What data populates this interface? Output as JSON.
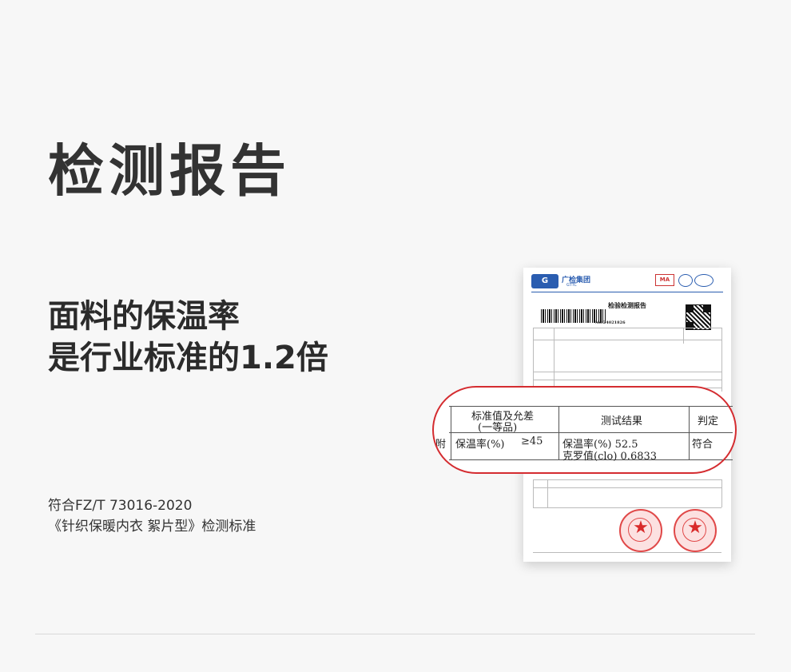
{
  "title": "检测报告",
  "headline": {
    "line1": "面料的保温率",
    "line2": "是行业标准的1.2倍"
  },
  "standard": {
    "line1": "符合FZ/T 73016-2020",
    "line2": "《针织保暖内衣 絮片型》检测标准"
  },
  "report": {
    "logo_label": "广检集团",
    "logo_sub": "GTTC",
    "ma_label": "MA",
    "doc_title": "检验检测报告",
    "report_no": "No:24021826"
  },
  "zoom": {
    "col_standard": "标准值及允差",
    "col_standard_sub": "(一等品)",
    "col_result": "测试结果",
    "col_judge": "判定",
    "row_prefix": "附",
    "row_standard": "保温率(%)",
    "row_standard_value": "≥45",
    "row_result_1": "保温率(%)  52.5",
    "row_result_2": "克罗值(clo) 0.6833",
    "row_judge": "符合"
  },
  "colors": {
    "accent_red": "#d42c30",
    "logo_blue": "#2a5db0"
  }
}
